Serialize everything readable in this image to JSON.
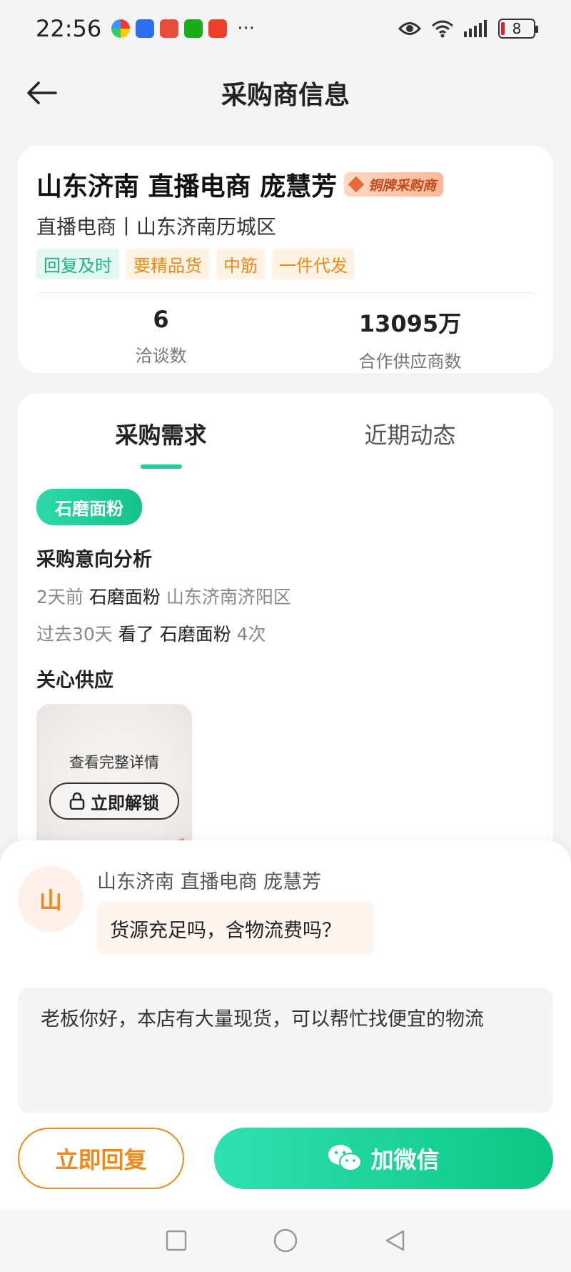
{
  "status_bar": {
    "time": "22:56",
    "battery": "8",
    "app_icons": [
      "colorful-app-icon",
      "blue-app-icon",
      "red-gift-app-icon",
      "wechat-icon",
      "red-app-icon"
    ],
    "more": "···"
  },
  "header": {
    "title": "采购商信息"
  },
  "profile": {
    "name": "山东济南 直播电商 庞慧芳",
    "badge": "铜牌采购商",
    "subinfo": "直播电商丨山东济南历城区",
    "tags": [
      {
        "label": "回复及时",
        "style": "green"
      },
      {
        "label": "要精品货",
        "style": "orange"
      },
      {
        "label": "中筋",
        "style": "orange"
      },
      {
        "label": "一件代发",
        "style": "orange"
      }
    ],
    "stats": [
      {
        "value": "6",
        "label": "洽谈数"
      },
      {
        "value": "13095万",
        "label": "合作供应商数"
      }
    ]
  },
  "detail": {
    "tabs": [
      {
        "label": "采购需求",
        "active": true
      },
      {
        "label": "近期动态",
        "active": false
      }
    ],
    "chip": "石磨面粉",
    "intent_title": "采购意向分析",
    "intent_line1": {
      "time": "2天前",
      "product": "石磨面粉",
      "region": "山东济南济阳区"
    },
    "intent_line2": {
      "time": "过去30天",
      "action": "看了 石磨面粉",
      "count": "4次"
    },
    "supply_title": "关心供应",
    "supply_overlay": "查看完整详情",
    "unlock_label": "立即解锁"
  },
  "chat": {
    "avatar_char": "山",
    "sender": "山东济南 直播电商 庞慧芳",
    "message": "货源充足吗，含物流费吗？",
    "reply_text": "老板你好，本店有大量现货，可以帮忙找便宜的物流",
    "reply_button": "立即回复",
    "wechat_button": "加微信"
  },
  "colors": {
    "accent_green": "#16c289",
    "accent_orange": "#f08a17"
  }
}
